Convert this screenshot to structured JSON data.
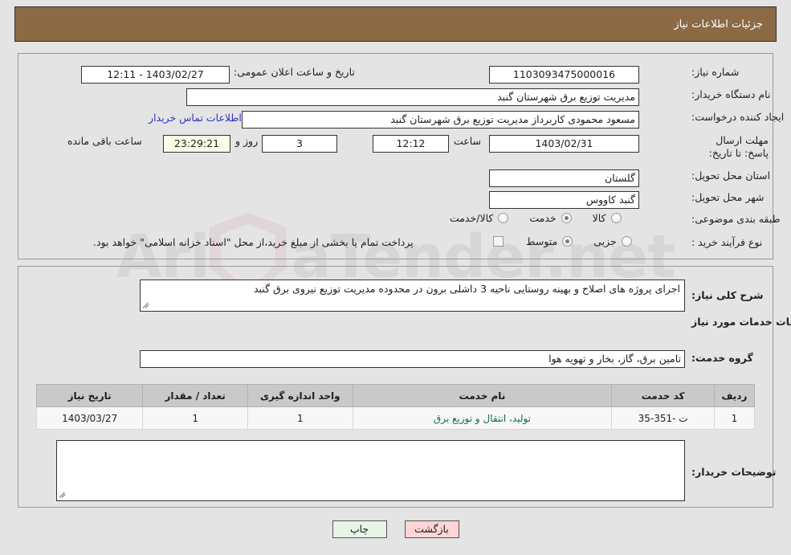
{
  "header": {
    "title": "جزئیات اطلاعات نیاز",
    "bg_color": "#8b6a45",
    "text_color": "#ffffff"
  },
  "watermark": {
    "text_left": "Ari",
    "text_right": "aTender.net",
    "icon": "shield-icon"
  },
  "form": {
    "need_number_label": "شماره نیاز:",
    "need_number_value": "1103093475000016",
    "announce_datetime_label": "تاریخ و ساعت اعلان عمومی:",
    "announce_datetime_value": "1403/02/27 - 12:11",
    "buyer_org_label": "نام دستگاه خریدار:",
    "buyer_org_value": "مدیریت توزیع برق شهرستان گنبد",
    "creator_label": "ایجاد کننده درخواست:",
    "creator_value": "مسعود محمودی کاربرداز مدیریت توزیع برق شهرستان گنبد",
    "buyer_contact_link": "اطلاعات تماس خریدار",
    "deadline_label": "مهلت ارسال پاسخ: تا تاریخ:",
    "deadline_date_value": "1403/02/31",
    "deadline_hour_label": "ساعت",
    "deadline_hour_value": "12:12",
    "remaining_days_value": "3",
    "remaining_days_suffix": "روز و",
    "remaining_time_value": "23:29:21",
    "remaining_time_suffix": "ساعت باقی مانده",
    "province_label": "استان محل تحویل:",
    "province_value": "گلستان",
    "city_label": "شهر محل تحویل:",
    "city_value": "گنبد کاووس",
    "category_label": "طبقه بندی موضوعی:",
    "category_options": [
      {
        "label": "کالا",
        "selected": false
      },
      {
        "label": "خدمت",
        "selected": true
      },
      {
        "label": "کالا/خدمت",
        "selected": false
      }
    ],
    "process_label": "نوع فرآیند خرید :",
    "process_options": [
      {
        "label": "جزیی",
        "selected": false
      },
      {
        "label": "متوسط",
        "selected": true
      }
    ],
    "treasury_checkbox_checked": false,
    "treasury_note": "پرداخت تمام یا بخشی از مبلغ خرید،از محل \"اسناد خزانه اسلامی\" خواهد بود."
  },
  "need_description": {
    "label": "شرح کلی نیاز:",
    "value": "اجرای پروژه های اصلاح و بهینه روستایی ناحیه 3 داشلی برون در محدوده مدیریت توزیع نیروی برق گنبد"
  },
  "services_section": {
    "heading": "اطلاعات خدمات مورد نیاز",
    "group_label": "گروه خدمت:",
    "group_value": "تامین برق، گاز، بخار و تهویه هوا",
    "columns": [
      "ردیف",
      "کد خدمت",
      "نام خدمت",
      "واحد اندازه گیری",
      "تعداد / مقدار",
      "تاریخ نیاز"
    ],
    "rows": [
      {
        "index": "1",
        "service_code": "ت -351-35",
        "service_name": "تولید، انتقال و توزیع برق",
        "unit": "1",
        "quantity": "1",
        "need_date": "1403/03/27"
      }
    ]
  },
  "buyer_notes": {
    "label": "توضیحات خریدار:",
    "value": ""
  },
  "buttons": {
    "back": "بازگشت",
    "print": "چاپ"
  }
}
